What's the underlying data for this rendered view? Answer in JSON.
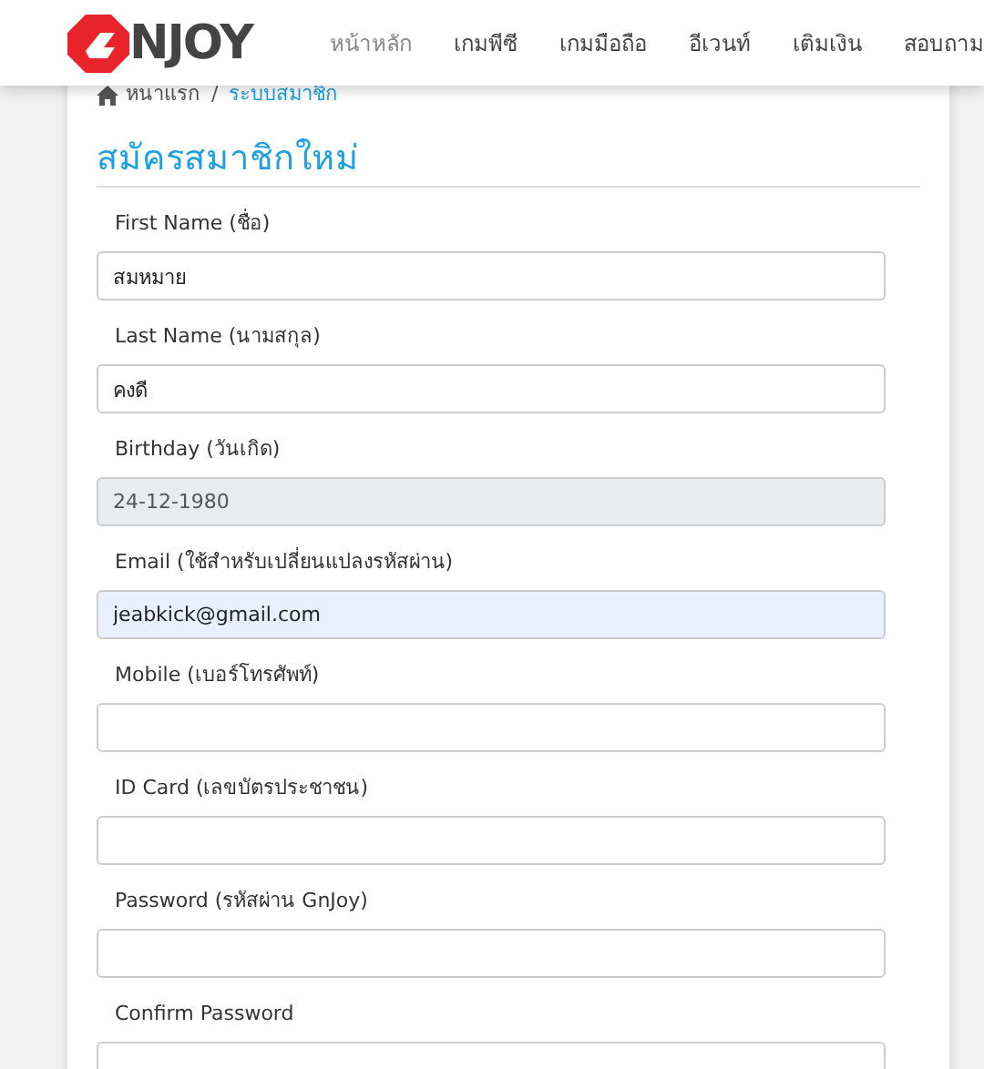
{
  "header": {
    "logo_text": "NJOY",
    "nav": [
      {
        "label": "หน้าหลัก",
        "selected": true
      },
      {
        "label": "เกมพีซี",
        "selected": false
      },
      {
        "label": "เกมมือถือ",
        "selected": false
      },
      {
        "label": "อีเวนท์",
        "selected": false
      },
      {
        "label": "เติมเงิน",
        "selected": false
      },
      {
        "label": "สอบถาม",
        "selected": false
      }
    ]
  },
  "breadcrumb": [
    {
      "label": "หนาแรก",
      "selected": false
    },
    {
      "label": "ระบบสมาชิก",
      "selected": true
    }
  ],
  "breadcrumb_separator": "/",
  "title": "สมัครสมาชิกใหม่",
  "fields": [
    {
      "label": "First Name (ชื่อ)",
      "value": "สมหมาย",
      "disabled": false,
      "highlighted": false
    },
    {
      "label": "Last Name (นามสกุล)",
      "value": "คงดี",
      "disabled": false,
      "highlighted": false
    },
    {
      "label": "Birthday (วันเกิด)",
      "value": "24-12-1980",
      "disabled": true,
      "highlighted": false
    },
    {
      "label": "Email (ใช้สำหรับเปลี่ยนแปลงรหัสผ่าน)",
      "value": "jeabkick@gmail.com",
      "disabled": false,
      "highlighted": true
    },
    {
      "label": "Mobile (เบอร์โทรศัพท์)",
      "disabled": false,
      "highlighted": false
    },
    {
      "label": "ID Card (เลขบัตรประชาชน)",
      "disabled": false,
      "highlighted": false
    },
    {
      "label": "Password (รหัสผ่าน GnJoy)",
      "disabled": false,
      "highlighted": false
    },
    {
      "label": "Confirm Password",
      "disabled": false,
      "highlighted": false
    }
  ]
}
